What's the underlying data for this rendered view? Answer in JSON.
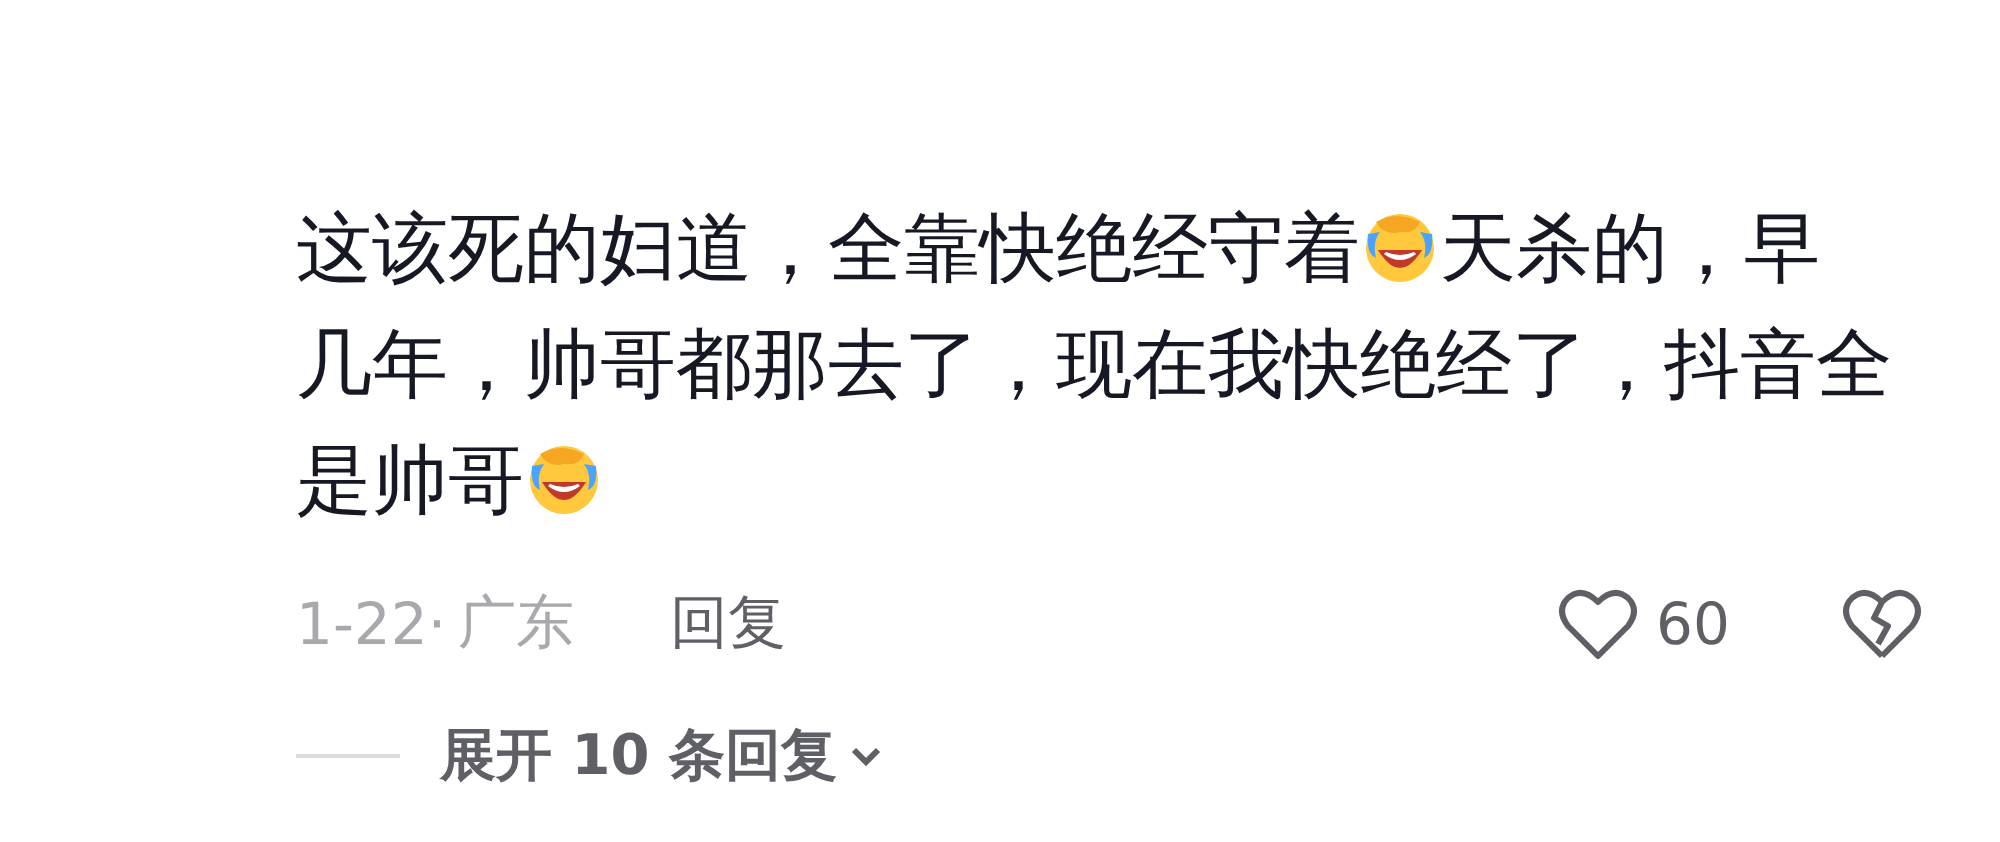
{
  "comment": {
    "lines": [
      [
        {
          "kind": "text",
          "text": "这该死的妇道，全靠快绝经守着"
        },
        {
          "kind": "emoji"
        },
        {
          "kind": "text",
          "text": "天杀的，早"
        }
      ],
      [
        {
          "kind": "text",
          "text": "几年，帅哥都那去了，现在我快绝经了，抖音全"
        }
      ],
      [
        {
          "kind": "text",
          "text": "是帅哥"
        },
        {
          "kind": "emoji"
        }
      ]
    ],
    "date": "1-22·",
    "location": "广东",
    "reply": "回复",
    "likes": "60"
  },
  "expand": {
    "label": "展开 10 条回复"
  }
}
